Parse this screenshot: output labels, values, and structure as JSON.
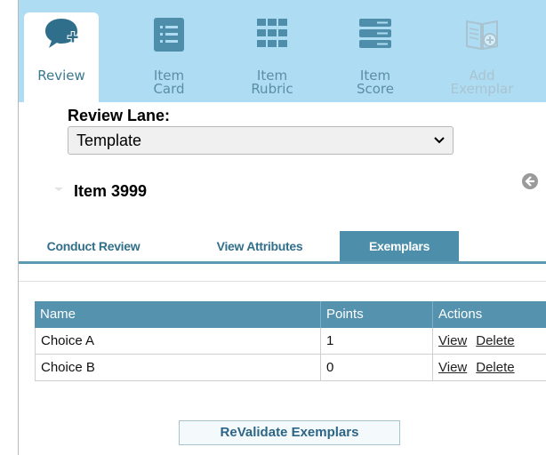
{
  "toolbar": {
    "items": [
      {
        "label_line1": "Review",
        "label_line2": "",
        "icon": "chat-add-icon"
      },
      {
        "label_line1": "Item",
        "label_line2": "Card",
        "icon": "item-card-icon"
      },
      {
        "label_line1": "Item",
        "label_line2": "Rubric",
        "icon": "grid-icon"
      },
      {
        "label_line1": "Item",
        "label_line2": "Score",
        "icon": "list-score-icon"
      },
      {
        "label_line1": "Add",
        "label_line2": "Exemplar",
        "icon": "book-add-icon"
      }
    ],
    "active_index": 0,
    "colors": {
      "bar": "#aedcf3",
      "icon": "#5a8ea5",
      "disabled": "#a9c4d0"
    }
  },
  "review_lane": {
    "label": "Review Lane:",
    "selected": "Template"
  },
  "item": {
    "title": "Item 3999"
  },
  "tabs": [
    {
      "label": "Conduct Review",
      "active": false
    },
    {
      "label": "View Attributes",
      "active": false
    },
    {
      "label": "Exemplars",
      "active": true
    }
  ],
  "table": {
    "headers": [
      "Name",
      "Points",
      "Actions"
    ],
    "rows": [
      {
        "name": "Choice A",
        "points": "1",
        "view": "View",
        "delete": "Delete"
      },
      {
        "name": "Choice B",
        "points": "0",
        "view": "View",
        "delete": "Delete"
      }
    ]
  },
  "revalidate_label": "ReValidate Exemplars",
  "colors": {
    "tab_active": "#4d8eaa",
    "table_header": "#5492ad"
  }
}
